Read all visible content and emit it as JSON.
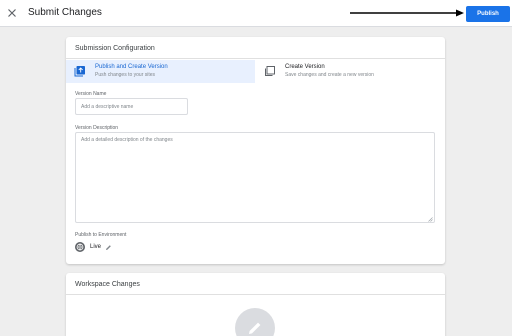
{
  "topbar": {
    "title": "Submit Changes",
    "publish_label": "Publish",
    "close_icon": "close-icon"
  },
  "config": {
    "title": "Submission Configuration",
    "options": [
      {
        "title": "Publish and Create Version",
        "subtitle": "Push changes to your sites",
        "selected": true
      },
      {
        "title": "Create Version",
        "subtitle": "Save changes and create a new version",
        "selected": false
      }
    ],
    "version_name": {
      "label": "Version Name",
      "value": "",
      "placeholder": "Add a descriptive name"
    },
    "version_description": {
      "label": "Version Description",
      "value": "",
      "placeholder": "Add a detailed description of the changes"
    },
    "environment": {
      "label": "Publish to Environment",
      "name": "Live"
    }
  },
  "workspace": {
    "title": "Workspace Changes"
  },
  "colors": {
    "accent": "#1a73e8",
    "selected_bg": "#e8f0fe",
    "selected_text": "#1967d2",
    "page_bg": "#eeeeee"
  }
}
